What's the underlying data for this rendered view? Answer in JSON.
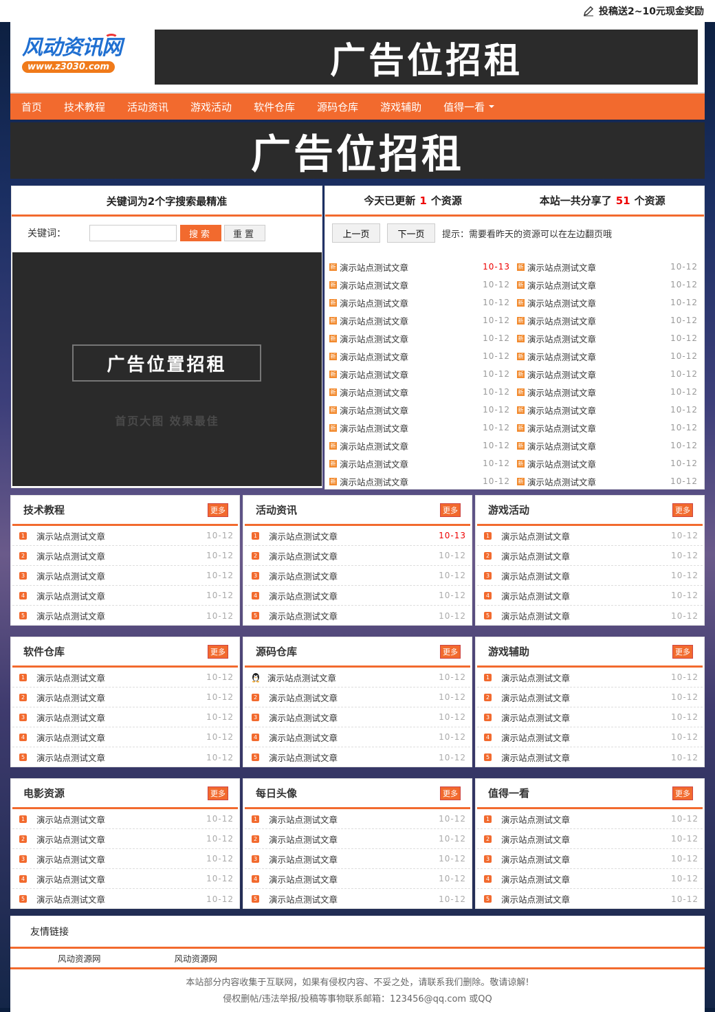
{
  "topbar": {
    "submit_text": "投稿送2~10元现金奖励",
    "icon": "pen-icon"
  },
  "header": {
    "logo_main": "风动资讯网",
    "logo_url": "www.z3030.com",
    "banner_text": "广告位招租"
  },
  "nav": {
    "items": [
      "首页",
      "技术教程",
      "活动资讯",
      "游戏活动",
      "软件仓库",
      "源码仓库",
      "游戏辅助",
      "值得一看"
    ]
  },
  "banner_mid": {
    "text": "广告位招租"
  },
  "search": {
    "title": "关键词为2个字搜索最精准",
    "label": "关键词：",
    "value": "",
    "search_btn": "搜索",
    "reset_btn": "重置"
  },
  "ad_left": {
    "main": "广告位置招租",
    "sub": "首页大图 效果最佳"
  },
  "stats": {
    "today_prefix": "今天已更新",
    "today_count": "1",
    "today_suffix": "个资源",
    "total_prefix": "本站一共分享了",
    "total_count": "51",
    "total_suffix": "个资源"
  },
  "pager": {
    "prev": "上一页",
    "next": "下一页",
    "tip": "提示：需要看昨天的资源可以在左边翻页哦"
  },
  "new_badge": "新",
  "new_list": [
    {
      "title": "演示站点测试文章",
      "date": "10-13",
      "red": true
    },
    {
      "title": "演示站点测试文章",
      "date": "10-12",
      "red": false
    },
    {
      "title": "演示站点测试文章",
      "date": "10-12",
      "red": false
    },
    {
      "title": "演示站点测试文章",
      "date": "10-12",
      "red": false
    },
    {
      "title": "演示站点测试文章",
      "date": "10-12",
      "red": false
    },
    {
      "title": "演示站点测试文章",
      "date": "10-12",
      "red": false
    },
    {
      "title": "演示站点测试文章",
      "date": "10-12",
      "red": false
    },
    {
      "title": "演示站点测试文章",
      "date": "10-12",
      "red": false
    },
    {
      "title": "演示站点测试文章",
      "date": "10-12",
      "red": false
    },
    {
      "title": "演示站点测试文章",
      "date": "10-12",
      "red": false
    },
    {
      "title": "演示站点测试文章",
      "date": "10-12",
      "red": false
    },
    {
      "title": "演示站点测试文章",
      "date": "10-12",
      "red": false
    },
    {
      "title": "演示站点测试文章",
      "date": "10-12",
      "red": false
    },
    {
      "title": "演示站点测试文章",
      "date": "10-12",
      "red": false
    },
    {
      "title": "演示站点测试文章",
      "date": "10-12",
      "red": false
    },
    {
      "title": "演示站点测试文章",
      "date": "10-12",
      "red": false
    },
    {
      "title": "演示站点测试文章",
      "date": "10-12",
      "red": false
    },
    {
      "title": "演示站点测试文章",
      "date": "10-12",
      "red": false
    },
    {
      "title": "演示站点测试文章",
      "date": "10-12",
      "red": false
    },
    {
      "title": "演示站点测试文章",
      "date": "10-12",
      "red": false
    },
    {
      "title": "演示站点测试文章",
      "date": "10-12",
      "red": false
    },
    {
      "title": "演示站点测试文章",
      "date": "10-12",
      "red": false
    },
    {
      "title": "演示站点测试文章",
      "date": "10-12",
      "red": false
    },
    {
      "title": "演示站点测试文章",
      "date": "10-12",
      "red": false
    },
    {
      "title": "演示站点测试文章",
      "date": "10-12",
      "red": false
    },
    {
      "title": "演示站点测试文章",
      "date": "10-12",
      "red": false
    }
  ],
  "more_label": "更多",
  "sections": [
    {
      "name": "技术教程",
      "items": [
        {
          "n": "1",
          "title": "演示站点测试文章",
          "date": "10-12"
        },
        {
          "n": "2",
          "title": "演示站点测试文章",
          "date": "10-12"
        },
        {
          "n": "3",
          "title": "演示站点测试文章",
          "date": "10-12"
        },
        {
          "n": "4",
          "title": "演示站点测试文章",
          "date": "10-12"
        },
        {
          "n": "5",
          "title": "演示站点测试文章",
          "date": "10-12"
        }
      ]
    },
    {
      "name": "活动资讯",
      "items": [
        {
          "n": "1",
          "title": "演示站点测试文章",
          "date": "10-13",
          "red": true
        },
        {
          "n": "2",
          "title": "演示站点测试文章",
          "date": "10-12"
        },
        {
          "n": "3",
          "title": "演示站点测试文章",
          "date": "10-12"
        },
        {
          "n": "4",
          "title": "演示站点测试文章",
          "date": "10-12"
        },
        {
          "n": "5",
          "title": "演示站点测试文章",
          "date": "10-12"
        }
      ]
    },
    {
      "name": "游戏活动",
      "items": [
        {
          "n": "1",
          "title": "演示站点测试文章",
          "date": "10-12"
        },
        {
          "n": "2",
          "title": "演示站点测试文章",
          "date": "10-12"
        },
        {
          "n": "3",
          "title": "演示站点测试文章",
          "date": "10-12"
        },
        {
          "n": "4",
          "title": "演示站点测试文章",
          "date": "10-12"
        },
        {
          "n": "5",
          "title": "演示站点测试文章",
          "date": "10-12"
        }
      ]
    },
    {
      "name": "软件仓库",
      "items": [
        {
          "n": "1",
          "title": "演示站点测试文章",
          "date": "10-12"
        },
        {
          "n": "2",
          "title": "演示站点测试文章",
          "date": "10-12"
        },
        {
          "n": "3",
          "title": "演示站点测试文章",
          "date": "10-12"
        },
        {
          "n": "4",
          "title": "演示站点测试文章",
          "date": "10-12"
        },
        {
          "n": "5",
          "title": "演示站点测试文章",
          "date": "10-12"
        }
      ]
    },
    {
      "name": "源码仓库",
      "items": [
        {
          "n": "qq",
          "title": "演示站点测试文章",
          "date": "10-12"
        },
        {
          "n": "2",
          "title": "演示站点测试文章",
          "date": "10-12"
        },
        {
          "n": "3",
          "title": "演示站点测试文章",
          "date": "10-12"
        },
        {
          "n": "4",
          "title": "演示站点测试文章",
          "date": "10-12"
        },
        {
          "n": "5",
          "title": "演示站点测试文章",
          "date": "10-12"
        }
      ]
    },
    {
      "name": "游戏辅助",
      "items": [
        {
          "n": "1",
          "title": "演示站点测试文章",
          "date": "10-12"
        },
        {
          "n": "2",
          "title": "演示站点测试文章",
          "date": "10-12"
        },
        {
          "n": "3",
          "title": "演示站点测试文章",
          "date": "10-12"
        },
        {
          "n": "4",
          "title": "演示站点测试文章",
          "date": "10-12"
        },
        {
          "n": "5",
          "title": "演示站点测试文章",
          "date": "10-12"
        }
      ]
    },
    {
      "name": "电影资源",
      "items": [
        {
          "n": "1",
          "title": "演示站点测试文章",
          "date": "10-12"
        },
        {
          "n": "2",
          "title": "演示站点测试文章",
          "date": "10-12"
        },
        {
          "n": "3",
          "title": "演示站点测试文章",
          "date": "10-12"
        },
        {
          "n": "4",
          "title": "演示站点测试文章",
          "date": "10-12"
        },
        {
          "n": "5",
          "title": "演示站点测试文章",
          "date": "10-12"
        }
      ]
    },
    {
      "name": "每日头像",
      "items": [
        {
          "n": "1",
          "title": "演示站点测试文章",
          "date": "10-12"
        },
        {
          "n": "2",
          "title": "演示站点测试文章",
          "date": "10-12"
        },
        {
          "n": "3",
          "title": "演示站点测试文章",
          "date": "10-12"
        },
        {
          "n": "4",
          "title": "演示站点测试文章",
          "date": "10-12"
        },
        {
          "n": "5",
          "title": "演示站点测试文章",
          "date": "10-12"
        }
      ]
    },
    {
      "name": "值得一看",
      "items": [
        {
          "n": "1",
          "title": "演示站点测试文章",
          "date": "10-12"
        },
        {
          "n": "2",
          "title": "演示站点测试文章",
          "date": "10-12"
        },
        {
          "n": "3",
          "title": "演示站点测试文章",
          "date": "10-12"
        },
        {
          "n": "4",
          "title": "演示站点测试文章",
          "date": "10-12"
        },
        {
          "n": "5",
          "title": "演示站点测试文章",
          "date": "10-12"
        }
      ]
    }
  ],
  "friend_links": {
    "title": "友情链接",
    "links": [
      "风动资源网",
      "风动资源网"
    ]
  },
  "footer": {
    "line1": "本站部分内容收集于互联网，如果有侵权内容、不妥之处，请联系我们删除。敬请谅解!",
    "line2": "侵权删帖/违法举报/投稿等事物联系邮箱：123456@qq.com 或QQ"
  },
  "colors": {
    "accent": "#f26a2e",
    "dark_banner": "#2b2b2b",
    "highlight_red": "#e00000"
  }
}
